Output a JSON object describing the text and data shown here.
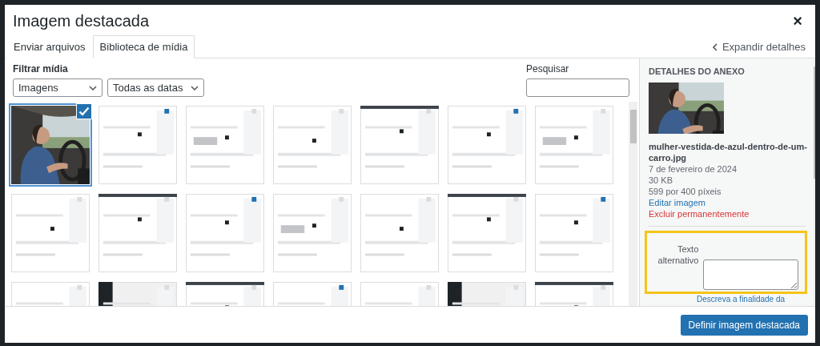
{
  "modal": {
    "title": "Imagem destacada",
    "close": "×"
  },
  "tabs": [
    {
      "label": "Enviar arquivos",
      "selected": false
    },
    {
      "label": "Biblioteca de mídia",
      "selected": true
    }
  ],
  "expand_link": "Expandir detalhes",
  "filter": {
    "label": "Filtrar mídia",
    "selects": [
      {
        "value": "Imagens"
      },
      {
        "value": "Todas as datas"
      }
    ]
  },
  "search": {
    "label": "Pesquisar"
  },
  "attachments": [
    {
      "kind": "picture",
      "selected": true
    },
    {
      "kind": "picture",
      "selected": false
    },
    {
      "kind": "picture",
      "selected": false
    },
    {
      "kind": "picture",
      "selected": false
    },
    {
      "kind": "picture",
      "selected": false
    },
    {
      "kind": "picture",
      "selected": false
    },
    {
      "kind": "picture",
      "selected": false
    },
    {
      "kind": "picture",
      "selected": false
    },
    {
      "kind": "picture",
      "selected": false
    },
    {
      "kind": "picture",
      "selected": false
    },
    {
      "kind": "picture",
      "selected": false
    },
    {
      "kind": "picture",
      "selected": false
    },
    {
      "kind": "picture",
      "selected": false
    },
    {
      "kind": "picture",
      "selected": false
    },
    {
      "kind": "picture",
      "selected": false
    },
    {
      "kind": "picture",
      "selected": false
    },
    {
      "kind": "picture",
      "selected": false
    },
    {
      "kind": "picture",
      "selected": false
    },
    {
      "kind": "picture",
      "selected": false
    },
    {
      "kind": "picture",
      "selected": false
    },
    {
      "kind": "picture",
      "selected": false
    }
  ],
  "details": {
    "heading": "DETALHES DO ANEXO",
    "filename": "mulher-vestida-de-azul-dentro-de-um-carro.jpg",
    "date": "7 de fevereiro de 2024",
    "size": "30 KB",
    "dimensions": "599 por 400 píxeis",
    "edit_link": "Editar imagem",
    "delete_link": "Excluir permanentemente",
    "alt_label": "Texto alternativo",
    "alt_help": "Descreva a finalidade da"
  },
  "primary_button": "Definir imagem destacada"
}
